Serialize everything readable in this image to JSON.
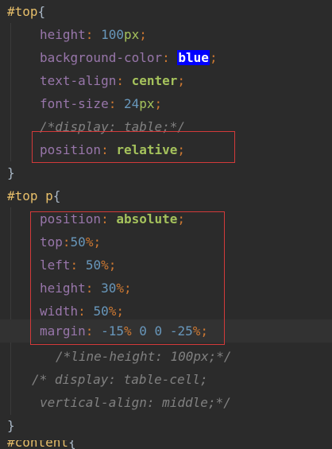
{
  "code": {
    "l1_selector": "#top",
    "l1_brace": "{",
    "l2_prop": "height",
    "l2_colon": ":",
    "l2_num": "100",
    "l2_unit": "px",
    "l2_semi": ";",
    "l3_prop": "background-color",
    "l3_colon": ":",
    "l3_val": "blue",
    "l3_semi": ";",
    "l4_prop": "text-align",
    "l4_colon": ":",
    "l4_val": "center",
    "l4_semi": ";",
    "l5_prop": "font-size",
    "l5_colon": ":",
    "l5_num": "24",
    "l5_unit": "px",
    "l5_semi": ";",
    "l6_comment": "/*display: table;*/",
    "l7_prop": "position",
    "l7_colon": ":",
    "l7_val": "relative",
    "l7_semi": ";",
    "l8_brace": "}",
    "l9_selector": "#top p",
    "l9_brace": "{",
    "l10_prop": "position",
    "l10_colon": ":",
    "l10_val": "absolute",
    "l10_semi": ";",
    "l11_prop": "top",
    "l11_colon": ":",
    "l11_num": "50",
    "l11_unit": "%",
    "l11_semi": ";",
    "l12_prop": "left",
    "l12_colon": ":",
    "l12_num": "50",
    "l12_unit": "%",
    "l12_semi": ";",
    "l13_prop": "height",
    "l13_colon": ":",
    "l13_num": "30",
    "l13_unit": "%",
    "l13_semi": ";",
    "l14_prop": "width",
    "l14_colon": ":",
    "l14_num": "50",
    "l14_unit": "%",
    "l14_semi": ";",
    "l15_prop": "margin",
    "l15_colon": ":",
    "l15_num1": "-15",
    "l15_unit1": "%",
    "l15_num2": "0",
    "l15_num3": "0",
    "l15_num4": "-25",
    "l15_unit4": "%",
    "l15_semi": ";",
    "l16_comment": "/*line-height: 100px;*/",
    "l17_comment": "/* display: table-cell;",
    "l18_comment": "vertical-align: middle;*/",
    "l19_brace": "}",
    "l20_selector": "#content",
    "l20_brace": "{"
  },
  "colors": {
    "background": "#2b2b2b",
    "selector": "#e8bf6a",
    "property": "#9876aa",
    "number": "#6897bb",
    "keyword": "#a5c25c",
    "comment": "#808080",
    "highlight": "#0000ff",
    "annotation_box": "#d33a3a"
  }
}
